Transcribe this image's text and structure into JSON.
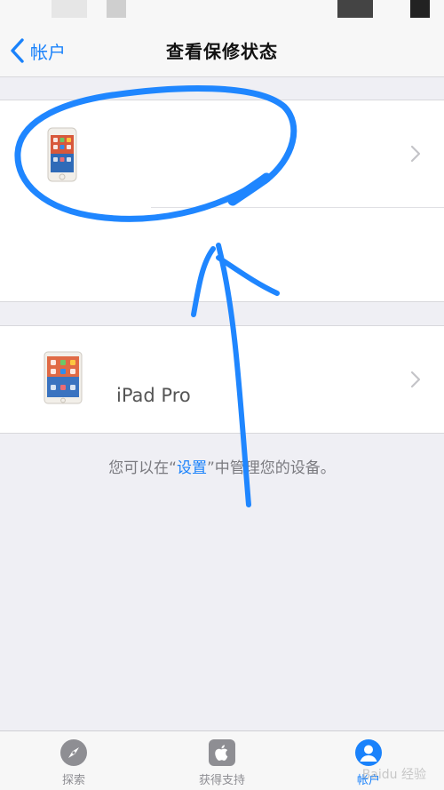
{
  "nav": {
    "back_label": "帐户",
    "title": "查看保修状态"
  },
  "devices": [
    {
      "name": "",
      "icon": "iphone-icon"
    },
    {
      "name": "iPad Pro",
      "icon": "ipad-icon"
    }
  ],
  "footer": {
    "prefix": "您可以在“",
    "link": "设置",
    "suffix": "”中管理您的设备。"
  },
  "tabs": [
    {
      "label": "探索",
      "icon": "compass-icon",
      "active": false
    },
    {
      "label": "获得支持",
      "icon": "apple-logo-icon",
      "active": false
    },
    {
      "label": "帐户",
      "icon": "account-icon",
      "active": true
    }
  ],
  "watermark": "Baidu 经验",
  "colors": {
    "accent": "#1a82fb",
    "annotation": "#1f86ff",
    "background": "#efeff4"
  }
}
